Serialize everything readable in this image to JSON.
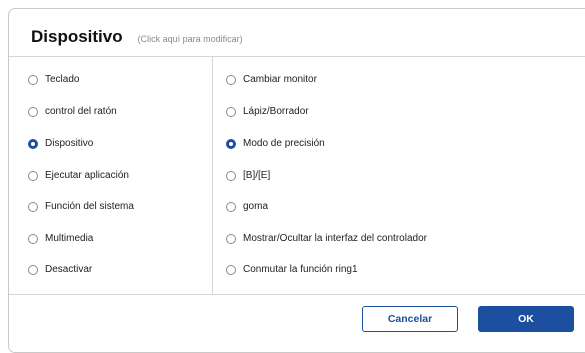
{
  "dialog": {
    "title": "Dispositivo",
    "hint": "(Click aquí para modificar)"
  },
  "left_options": [
    {
      "label": "Teclado",
      "selected": false
    },
    {
      "label": "control del ratón",
      "selected": false
    },
    {
      "label": "Dispositivo",
      "selected": true
    },
    {
      "label": "Ejecutar aplicación",
      "selected": false
    },
    {
      "label": "Función del sistema",
      "selected": false
    },
    {
      "label": "Multimedia",
      "selected": false
    },
    {
      "label": "Desactivar",
      "selected": false
    }
  ],
  "right_options": [
    {
      "label": "Cambiar monitor",
      "selected": false
    },
    {
      "label": "Lápiz/Borrador",
      "selected": false
    },
    {
      "label": "Modo de precisión",
      "selected": true
    },
    {
      "label": "[B]/[E]",
      "selected": false
    },
    {
      "label": "goma",
      "selected": false
    },
    {
      "label": "Mostrar/Ocultar la interfaz del controlador",
      "selected": false
    },
    {
      "label": "Conmutar la función ring1",
      "selected": false
    }
  ],
  "buttons": {
    "cancel": "Cancelar",
    "ok": "OK"
  },
  "colors": {
    "accent": "#1d4fa0",
    "border": "#c9c9c9"
  }
}
